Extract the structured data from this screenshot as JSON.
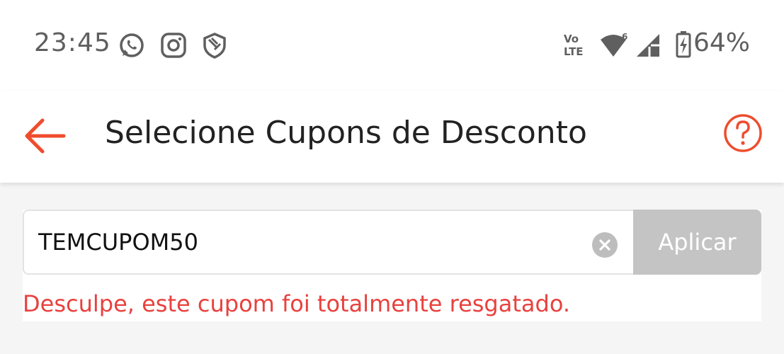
{
  "status_bar": {
    "time": "23:45",
    "left_icons": [
      "whatsapp-icon",
      "instagram-icon",
      "shield-icon"
    ],
    "right_icons": [
      "volte-icon",
      "wifi-icon",
      "signal-icon",
      "battery-charging-icon"
    ],
    "volte_label_top": "Vo",
    "volte_label_bottom": "LTE",
    "wifi_badge": "6",
    "battery": "64%"
  },
  "header": {
    "title": "Selecione Cupons de Desconto",
    "back_icon": "arrow-left-icon",
    "help_icon": "help-circle-icon",
    "accent_color": "#ee4d2d"
  },
  "coupon_form": {
    "input_value": "TEMCUPOM50",
    "clear_icon": "clear-icon",
    "apply_label": "Aplicar",
    "error_message": "Desculpe, este cupom foi totalmente resgatado.",
    "error_color": "#e8413e",
    "apply_disabled_color": "#c4c4c4"
  }
}
